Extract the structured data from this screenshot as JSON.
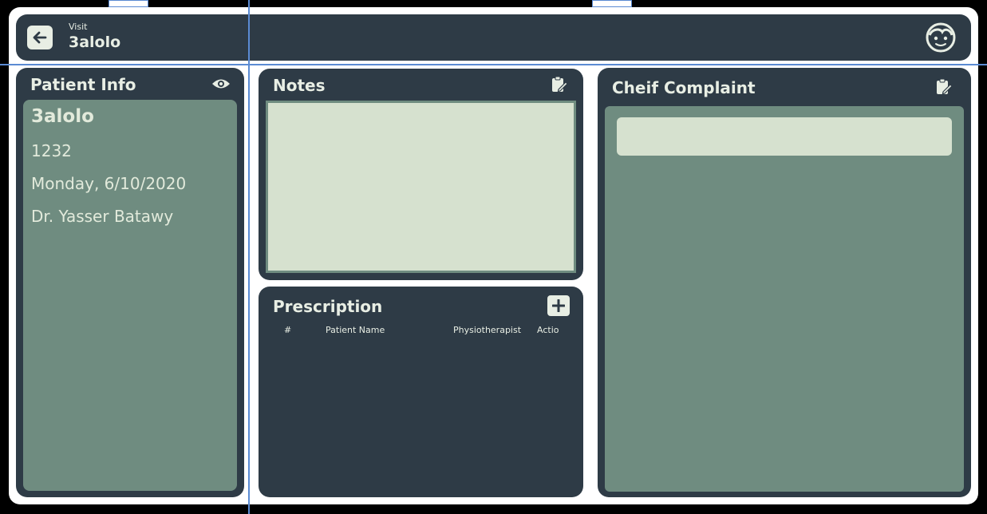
{
  "header": {
    "kicker": "Visit",
    "title": "3alolo"
  },
  "patient_info": {
    "title": "Patient Info",
    "name": "3alolo",
    "id": "1232",
    "date": "Monday, 6/10/2020",
    "doctor": "Dr. Yasser Batawy"
  },
  "notes": {
    "title": "Notes",
    "value": ""
  },
  "prescription": {
    "title": "Prescription",
    "columns": [
      "#",
      "Patient Name",
      "Physiotherapist",
      "Actio"
    ],
    "rows": []
  },
  "chief_complaint": {
    "title": "Cheif Complaint",
    "value": ""
  },
  "colors": {
    "panel": "#2e3b46",
    "panel_inner": "#6f8c80",
    "field": "#d6e1cf",
    "text": "#e8eee4",
    "guide": "#5b8bd3"
  },
  "icons": {
    "back": "arrow-left-icon",
    "avatar": "face-icon",
    "view": "eye-icon",
    "edit": "clipboard-edit-icon",
    "add": "plus-icon"
  }
}
